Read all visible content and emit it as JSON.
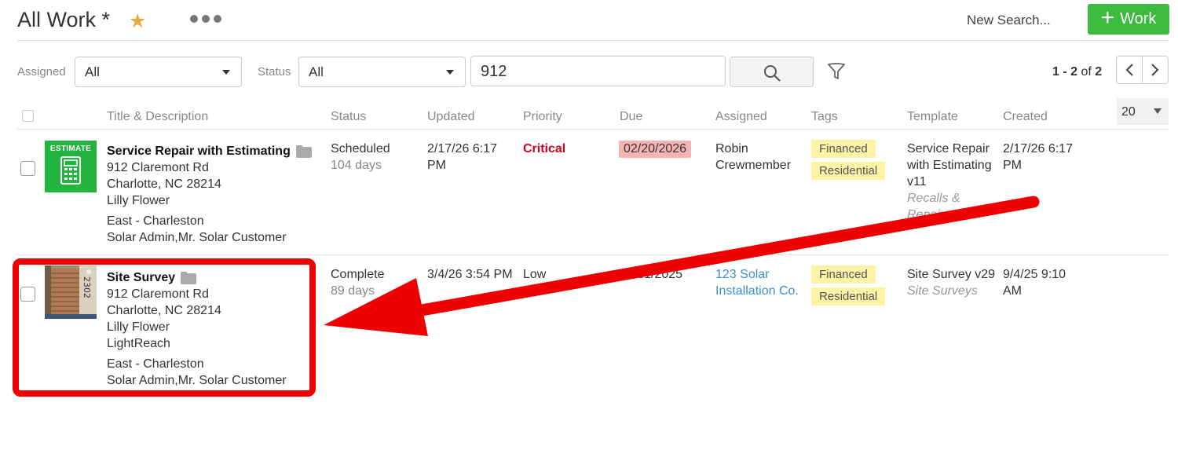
{
  "header": {
    "title": "All Work *",
    "new_search": "New Search...",
    "add_button": "Work",
    "add_plus": "+"
  },
  "filters": {
    "assigned_label": "Assigned",
    "assigned_value": "All",
    "status_label": "Status",
    "status_value": "All",
    "search_value": "912"
  },
  "pager": {
    "range": "1 - 2",
    "of_text": "of",
    "total": "2",
    "page_size": "20"
  },
  "columns": [
    "Title & Description",
    "Status",
    "Updated",
    "Priority",
    "Due",
    "Assigned",
    "Tags",
    "Template",
    "Created"
  ],
  "rows": [
    {
      "thumb_label": "ESTIMATE",
      "title": "Service Repair with Estimating",
      "address1": "912 Claremont Rd",
      "address2": "Charlotte, NC 28214",
      "contact": "Lilly Flower",
      "extra": "",
      "region": "East - Charleston",
      "team": "Solar Admin,Mr. Solar Customer",
      "status": "Scheduled",
      "status_age": "104 days",
      "updated": "2/17/26 6:17 PM",
      "priority": "Critical",
      "due": "02/20/2026",
      "assigned": "Robin Crewmember",
      "tags": [
        "Financed",
        "Residential"
      ],
      "template": "Service Repair with Estimating v11",
      "template_sub": "Recalls & Repairs",
      "created": "2/17/26 6:17 PM"
    },
    {
      "thumb_label": "",
      "title": "Site Survey",
      "address1": "912 Claremont Rd",
      "address2": "Charlotte, NC 28214",
      "contact": "Lilly Flower",
      "extra": "LightReach",
      "region": "East - Charleston",
      "team": "Solar Admin,Mr. Solar Customer",
      "status": "Complete",
      "status_age": "89 days",
      "updated": "3/4/26 3:54 PM",
      "priority": "Low",
      "due": "12/31/2025",
      "assigned": "123 Solar Installation Co.",
      "tags": [
        "Financed",
        "Residential"
      ],
      "template": "Site Survey v29",
      "template_sub": "Site Surveys",
      "created": "9/4/25 9:10 AM"
    }
  ],
  "house_number": "2302",
  "colors": {
    "accent_green": "#3dbb3f",
    "critical": "#d0021b",
    "annotation_red": "#ee0000",
    "tag_yellow": "#fbf3a6",
    "link_blue": "#3a8fd6"
  }
}
